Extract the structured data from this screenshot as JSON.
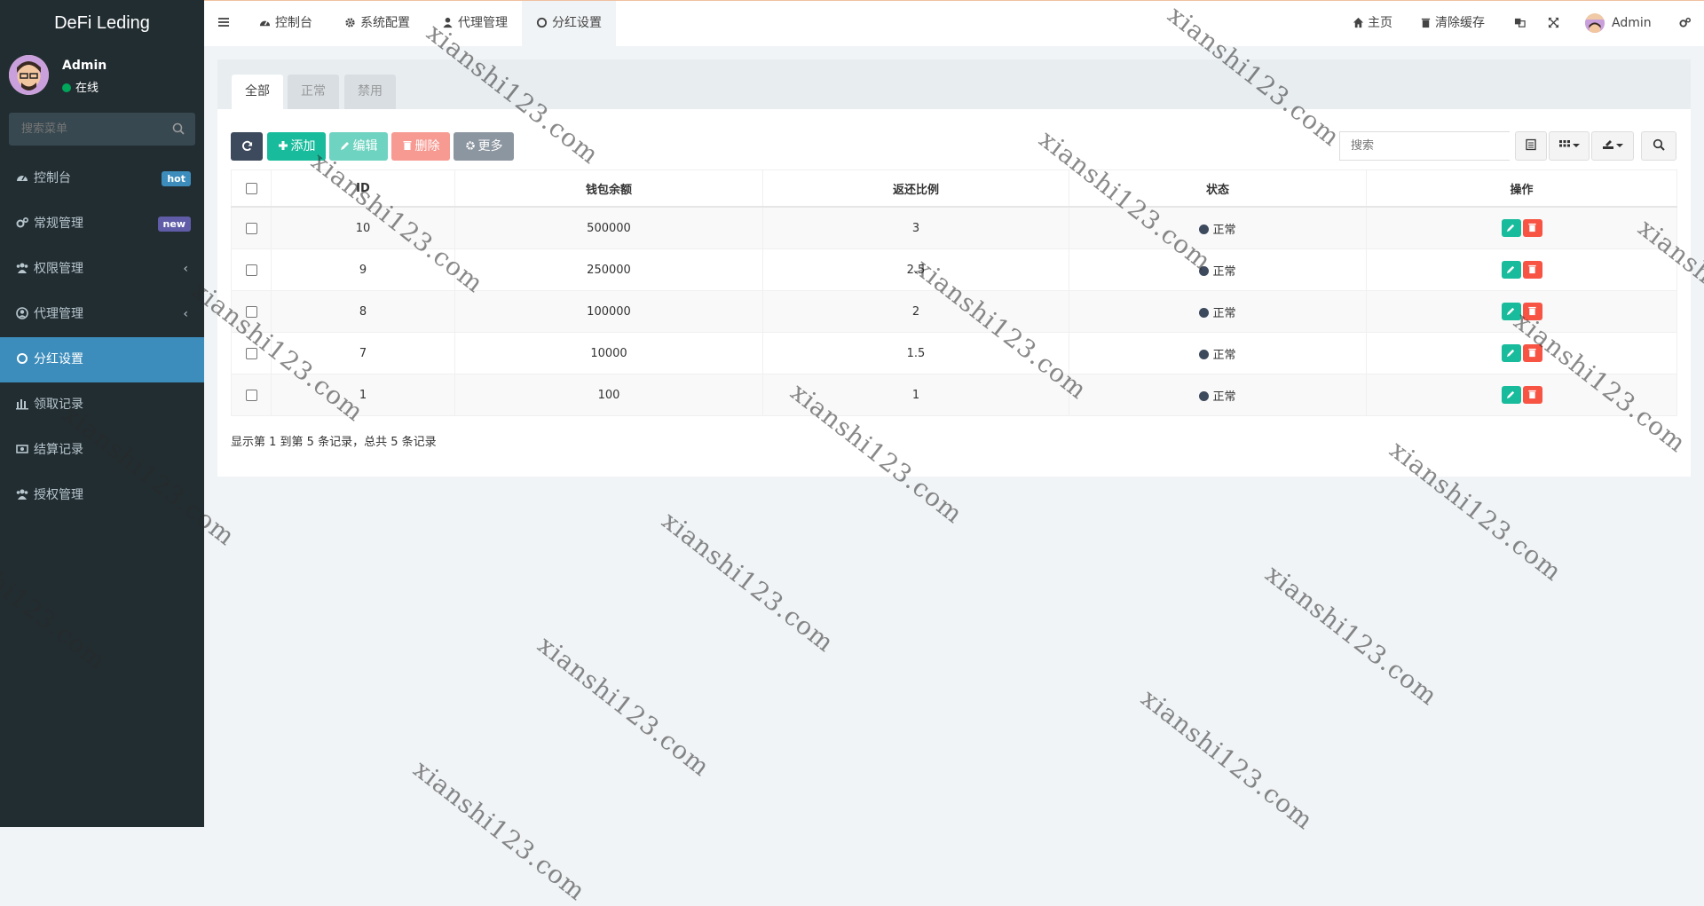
{
  "brand": "DeFi Leding",
  "user": {
    "name": "Admin",
    "status": "在线"
  },
  "sidebar": {
    "search_placeholder": "搜索菜单",
    "items": [
      {
        "label": "控制台",
        "icon": "dashboard-icon",
        "badge": "hot"
      },
      {
        "label": "常规管理",
        "icon": "cogs-icon",
        "badge": "new"
      },
      {
        "label": "权限管理",
        "icon": "group-icon",
        "chevron": "‹"
      },
      {
        "label": "代理管理",
        "icon": "user-circle-icon",
        "chevron": "‹"
      },
      {
        "label": "分红设置",
        "icon": "circle-icon",
        "active": true
      },
      {
        "label": "领取记录",
        "icon": "bars-chart-icon"
      },
      {
        "label": "结算记录",
        "icon": "money-icon"
      },
      {
        "label": "授权管理",
        "icon": "group-icon"
      }
    ]
  },
  "header": {
    "tabs": [
      {
        "label": "控制台",
        "icon": "dashboard-icon"
      },
      {
        "label": "系统配置",
        "icon": "gear-icon"
      },
      {
        "label": "代理管理",
        "icon": "user-icon"
      },
      {
        "label": "分红设置",
        "icon": "circle-icon",
        "active": true
      }
    ],
    "right": {
      "home": "主页",
      "clear_cache": "清除缓存",
      "admin": "Admin"
    }
  },
  "content": {
    "tabs": [
      "全部",
      "正常",
      "禁用"
    ],
    "toolbar": {
      "add": "添加",
      "edit": "编辑",
      "delete": "删除",
      "more": "更多",
      "search_placeholder": "搜索"
    },
    "table": {
      "headers": [
        "ID",
        "钱包余额",
        "返还比例",
        "状态",
        "操作"
      ],
      "rows": [
        {
          "id": "10",
          "balance": "500000",
          "ratio": "3",
          "status": "正常"
        },
        {
          "id": "9",
          "balance": "250000",
          "ratio": "2.5",
          "status": "正常"
        },
        {
          "id": "8",
          "balance": "100000",
          "ratio": "2",
          "status": "正常"
        },
        {
          "id": "7",
          "balance": "10000",
          "ratio": "1.5",
          "status": "正常"
        },
        {
          "id": "1",
          "balance": "100",
          "ratio": "1",
          "status": "正常"
        }
      ]
    },
    "summary": "显示第 1 到第 5 条记录，总共 5 条记录"
  },
  "watermark": "xianshi123.com",
  "colors": {
    "sidebar_bg": "#222d32",
    "active_menu": "#3c8dbc",
    "add_button": "#18bc9c",
    "edit_button": "#6ed3c0",
    "delete_button": "#f79a92",
    "more_button": "#8c96a0",
    "refresh_button": "#3d4a5d"
  }
}
